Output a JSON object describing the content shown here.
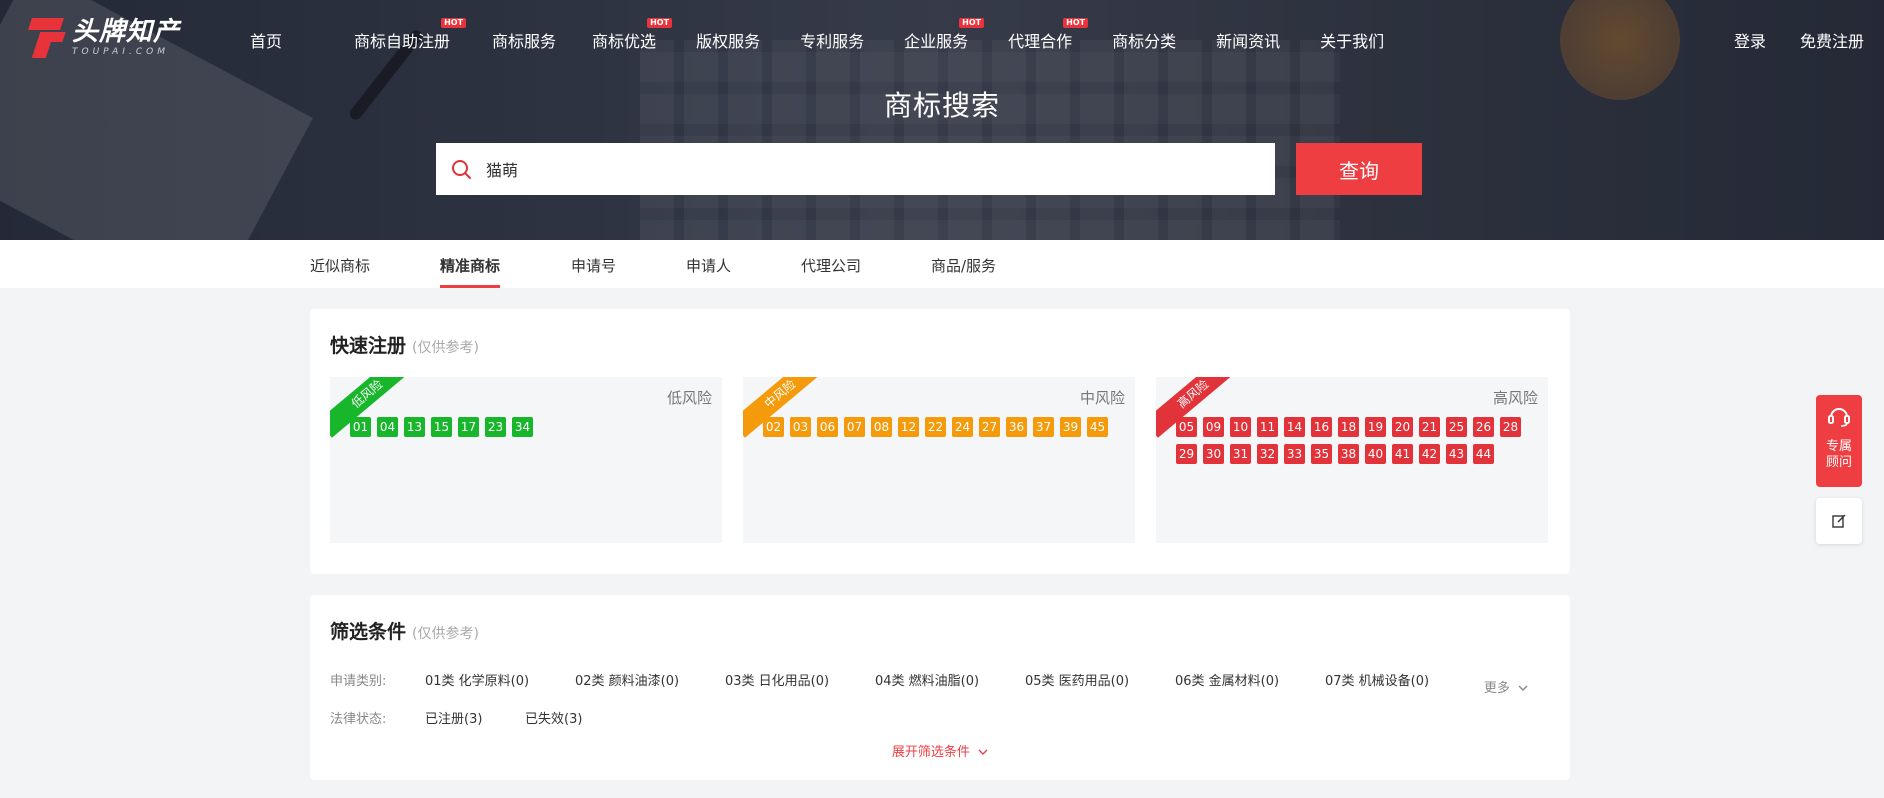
{
  "brand": {
    "name_cn": "头牌知产",
    "name_en": "TOUPAI.COM",
    "accent": "#ee3e42"
  },
  "nav": {
    "items": [
      {
        "label": "首页",
        "hot": false
      },
      {
        "label": "商标自助注册",
        "hot": true
      },
      {
        "label": "商标服务",
        "hot": false
      },
      {
        "label": "商标优选",
        "hot": true
      },
      {
        "label": "版权服务",
        "hot": false
      },
      {
        "label": "专利服务",
        "hot": false
      },
      {
        "label": "企业服务",
        "hot": true
      },
      {
        "label": "代理合作",
        "hot": true
      },
      {
        "label": "商标分类",
        "hot": false
      },
      {
        "label": "新闻资讯",
        "hot": false
      },
      {
        "label": "关于我们",
        "hot": false
      }
    ],
    "hot_badge": "HOT",
    "login": "登录",
    "register": "免费注册"
  },
  "hero": {
    "title": "商标搜索",
    "search_value": "猫萌",
    "search_button": "查询"
  },
  "tabs": [
    {
      "label": "近似商标",
      "active": false
    },
    {
      "label": "精准商标",
      "active": true
    },
    {
      "label": "申请号",
      "active": false
    },
    {
      "label": "申请人",
      "active": false
    },
    {
      "label": "代理公司",
      "active": false
    },
    {
      "label": "商品/服务",
      "active": false
    }
  ],
  "quick_register": {
    "title": "快速注册",
    "note": "(仅供参考)",
    "groups": [
      {
        "ribbon": "低风险",
        "label": "低风险",
        "color": "#17b62b",
        "codes": [
          "01",
          "04",
          "13",
          "15",
          "17",
          "23",
          "34"
        ]
      },
      {
        "ribbon": "中风险",
        "label": "中风险",
        "color": "#f59a0a",
        "codes": [
          "02",
          "03",
          "06",
          "07",
          "08",
          "12",
          "22",
          "24",
          "27",
          "36",
          "37",
          "39",
          "45"
        ]
      },
      {
        "ribbon": "高风险",
        "label": "高风险",
        "color": "#e2323a",
        "codes": [
          "05",
          "09",
          "10",
          "11",
          "14",
          "16",
          "18",
          "19",
          "20",
          "21",
          "25",
          "26",
          "28",
          "29",
          "30",
          "31",
          "32",
          "33",
          "35",
          "38",
          "40",
          "41",
          "42",
          "43",
          "44"
        ]
      }
    ]
  },
  "filters": {
    "title": "筛选条件",
    "note": "(仅供参考)",
    "class_key": "申请类别:",
    "class_options": [
      "01类 化学原料(0)",
      "02类 颜料油漆(0)",
      "03类 日化用品(0)",
      "04类 燃料油脂(0)",
      "05类 医药用品(0)",
      "06类 金属材料(0)",
      "07类 机械设备(0)"
    ],
    "more": "更多",
    "status_key": "法律状态:",
    "status_options": [
      "已注册(3)",
      "已失效(3)"
    ],
    "expand": "展开筛选条件"
  },
  "side": {
    "consult": [
      "专属",
      "顾问"
    ]
  }
}
